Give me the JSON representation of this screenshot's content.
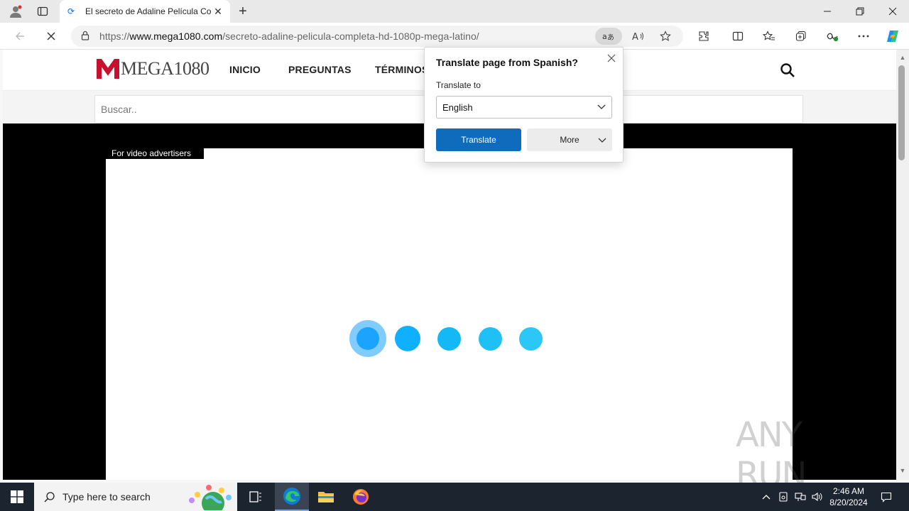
{
  "browser": {
    "tab_title": "El secreto de Adaline Película Co",
    "url_prefix": "https://",
    "url_host": "www.mega1080.com",
    "url_path": "/secreto-adaline-pelicula-completa-hd-1080p-mega-latino/"
  },
  "site": {
    "logo_text": "MEGA1080",
    "menu": [
      "INICIO",
      "PREGUNTAS",
      "TÉRMINOS"
    ],
    "search_placeholder": "Buscar.."
  },
  "ad": {
    "label": "For video advertisers",
    "loading_dot_colors": [
      "#1aa3ff",
      "#0fb0ff",
      "#14b8f5",
      "#1ec0f5",
      "#2ac7f7"
    ]
  },
  "translate_popup": {
    "title": "Translate page from Spanish?",
    "translate_to_label": "Translate to",
    "selected_language": "English",
    "translate_button": "Translate",
    "more_button": "More"
  },
  "watermark": "ANY RUN",
  "taskbar": {
    "search_placeholder": "Type here to search",
    "time": "2:46 AM",
    "date": "8/20/2024"
  },
  "colors": {
    "accent": "#0f6cbd",
    "brand": "#c8102e"
  }
}
